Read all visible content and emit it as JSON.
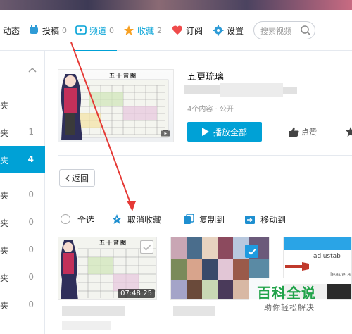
{
  "nav": {
    "dynamic": "动态",
    "submissions": {
      "label": "投稿",
      "count": "0"
    },
    "channels": {
      "label": "频道",
      "count": "0"
    },
    "favorites": {
      "label": "收藏",
      "count": "2"
    },
    "subscriptions": "订阅",
    "settings": "设置",
    "search_placeholder": "搜索视频"
  },
  "sidebar": {
    "items": [
      {
        "label": "夹",
        "count": ""
      },
      {
        "label": "夹",
        "count": "1"
      },
      {
        "label": "夹",
        "count": "4"
      },
      {
        "label": "夹",
        "count": "0"
      },
      {
        "label": "夹",
        "count": "0"
      },
      {
        "label": "夹",
        "count": "0"
      },
      {
        "label": "夹",
        "count": "0"
      },
      {
        "label": "夹",
        "count": "0"
      }
    ]
  },
  "folder": {
    "cover_title": "五十音图",
    "title": "五更琉璃",
    "meta": "4个内容 · 公开",
    "play_all": "播放全部",
    "like": "点赞"
  },
  "back_label": "返回",
  "toolbar": {
    "select_all": "全选",
    "unfavorite": "取消收藏",
    "copy_to": "复制到",
    "move_to": "移动到"
  },
  "videos": [
    {
      "cover_title": "五十音图",
      "duration": "07:48:25"
    },
    {
      "duration": ""
    },
    {
      "cover_title": "adjustab",
      "subtitle": "leave a"
    }
  ],
  "watermark": {
    "title": "百科全说",
    "subtitle": "助你轻松解决"
  },
  "colors": {
    "accent": "#00a1d6",
    "annotation_arrow": "#e53935",
    "watermark_green": "#21a34a"
  }
}
